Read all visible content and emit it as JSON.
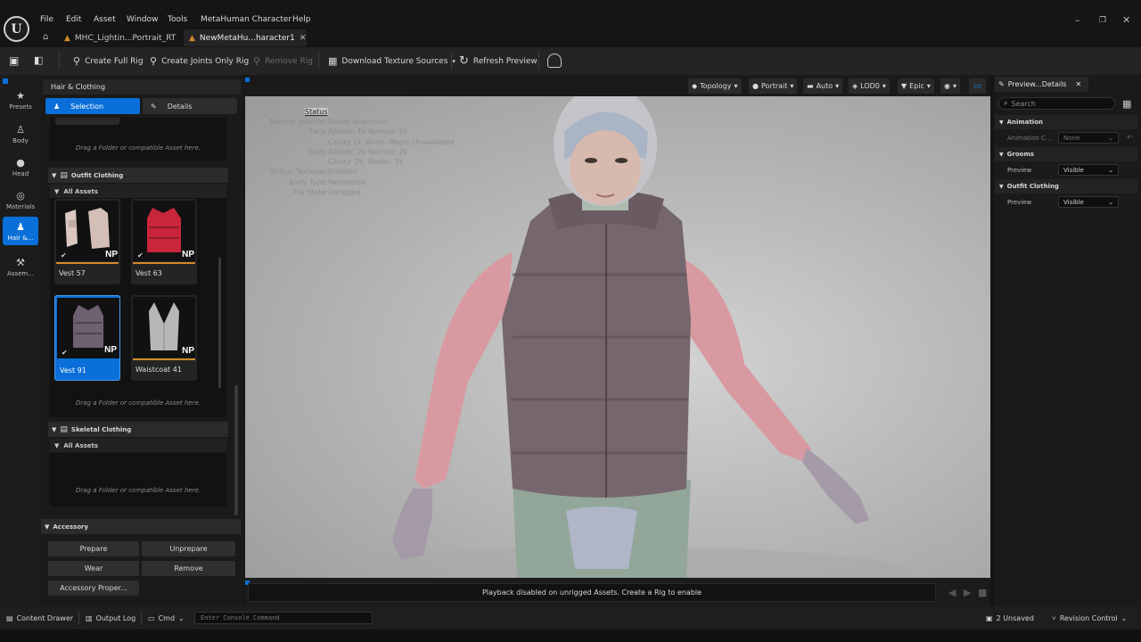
{
  "app": {
    "menu": [
      "File",
      "Edit",
      "Asset",
      "Window",
      "Tools",
      "MetaHuman Character",
      "Help"
    ],
    "tabs": [
      {
        "label": "MHC_Lightin...Portrait_RT"
      },
      {
        "label": "NewMetaHu...haracter1"
      }
    ]
  },
  "toolbar": {
    "create_full_rig": "Create Full Rig",
    "create_joints_only_rig": "Create Joints Only Rig",
    "remove_rig": "Remove Rig",
    "download_texture_sources": "Download Texture Sources",
    "refresh_preview": "Refresh Preview"
  },
  "leftstrip": {
    "items": [
      {
        "label": "Presets",
        "icon": "star-icon"
      },
      {
        "label": "Body",
        "icon": "body-icon"
      },
      {
        "label": "Head",
        "icon": "head-icon"
      },
      {
        "label": "Materials",
        "icon": "materials-icon"
      },
      {
        "label": "Hair &...",
        "icon": "hair-clothing-icon"
      },
      {
        "label": "Assem...",
        "icon": "assembly-icon"
      }
    ]
  },
  "leftpanel": {
    "title": "Hair & Clothing",
    "tab_selection": "Selection",
    "tab_details": "Details",
    "drag_hint": "Drag a Folder or compatible Asset here.",
    "outfit_clothing": {
      "title": "Outfit Clothing",
      "subheader": "All Assets",
      "items": [
        {
          "label": "Vest 57",
          "badge": "NP"
        },
        {
          "label": "Vest 63",
          "badge": "NP"
        },
        {
          "label": "Vest 91",
          "badge": "NP"
        },
        {
          "label": "Waistcoat 41",
          "badge": "NP"
        }
      ]
    },
    "skeletal_clothing": {
      "title": "Skeletal Clothing",
      "subheader": "All Assets"
    },
    "accessory": {
      "title": "Accessory",
      "prepare": "Prepare",
      "unprepare": "Unprepare",
      "wear": "Wear",
      "remove": "Remove",
      "properties": "Accessory Proper..."
    }
  },
  "viewport": {
    "buttons": {
      "topology": "Topology",
      "portrait": "Portrait",
      "auto": "Auto",
      "lod": "LOD0",
      "quality": "Epic"
    },
    "status_title": "Status",
    "status": [
      {
        "label": "Texture Sources:",
        "value": "Needs download"
      },
      {
        "label": "Face:",
        "value": "Albedo: 1k Normal: 1k"
      },
      {
        "label": "",
        "value": "Cavity 1k, Anim. Maps: Unavailable"
      },
      {
        "label": "Body:",
        "value": "Albedo: 2k Normal: 2k"
      },
      {
        "label": "",
        "value": "Cavity: 2k, Masks: 1k"
      },
      {
        "label": "Virtual Textures:",
        "value": "Enabled"
      },
      {
        "label": "Body Type:",
        "value": "Parametric"
      },
      {
        "label": "Rig State:",
        "value": "Unrigged"
      }
    ],
    "playback_message": "Playback disabled on unrigged Assets. Create a Rig to enable"
  },
  "details": {
    "tab_title": "Preview...Details",
    "search_placeholder": "Search",
    "sections": {
      "animation": "Animation",
      "animation_row_label": "Animation C...",
      "animation_row_value": "None",
      "grooms": "Grooms",
      "grooms_row_label": "Preview",
      "grooms_row_value": "Visible",
      "outfit": "Outfit Clothing",
      "outfit_row_label": "Preview",
      "outfit_row_value": "Visible"
    }
  },
  "statusbar": {
    "content_drawer": "Content Drawer",
    "output_log": "Output Log",
    "cmd": "Cmd",
    "console_placeholder": "Enter Console Command",
    "unsaved": "2 Unsaved",
    "revision_control": "Revision Control"
  },
  "colors": {
    "accent": "#0a6fd8",
    "unavailable": "#d08a2a"
  }
}
